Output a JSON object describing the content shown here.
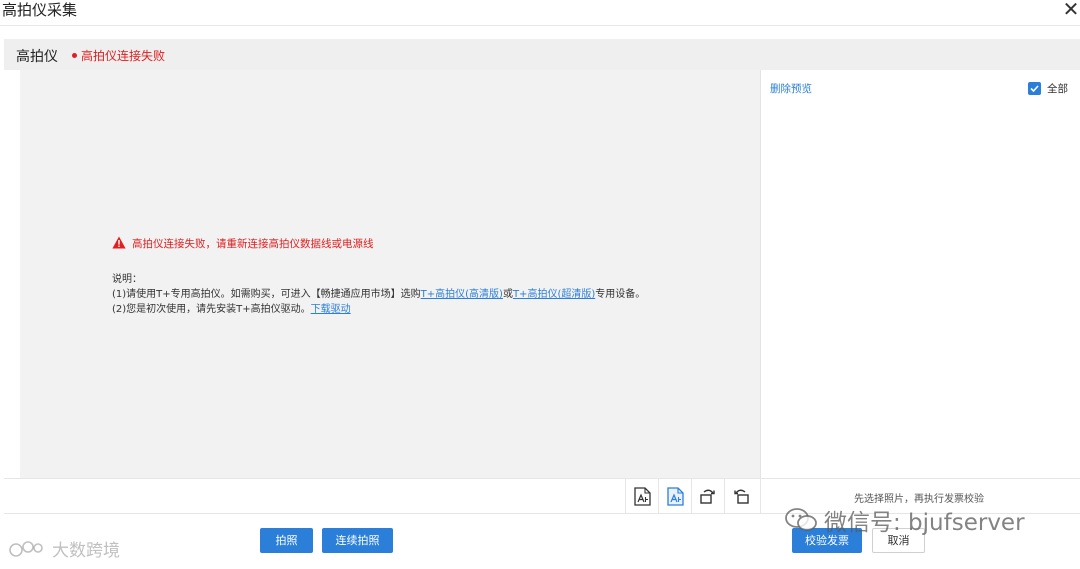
{
  "dialog": {
    "title": "高拍仪采集",
    "close": "✕"
  },
  "device": {
    "name": "高拍仪",
    "status": "高拍仪连接失败",
    "status_color": "#e02020"
  },
  "preview": {
    "error": "高拍仪连接失败，请重新连接高拍仪数据线或电源线",
    "desc_title": "说明：",
    "line1_prefix": "(1)请使用T+专用高拍仪。如需购买，可进入【畅捷通应用市场】选购",
    "line1_link1": "T+高拍仪(高清版)",
    "line1_mid": "或",
    "line1_link2": "T+高拍仪(超清版)",
    "line1_suffix": "专用设备。",
    "line2_prefix": "(2)您是初次使用，请先安装T+高拍仪驱动。",
    "line2_link": "下载驱动"
  },
  "side": {
    "delete_preview": "删除预览",
    "select_all": "全部",
    "hint": "先选择照片，再执行发票校验"
  },
  "buttons": {
    "capture": "拍照",
    "continuous": "连续拍照",
    "verify": "校验发票",
    "cancel": "取消"
  },
  "watermarks": {
    "left": "大数跨境",
    "right": "微信号: bjufserver"
  },
  "colors": {
    "accent": "#2b7fd8",
    "error": "#e02020"
  }
}
